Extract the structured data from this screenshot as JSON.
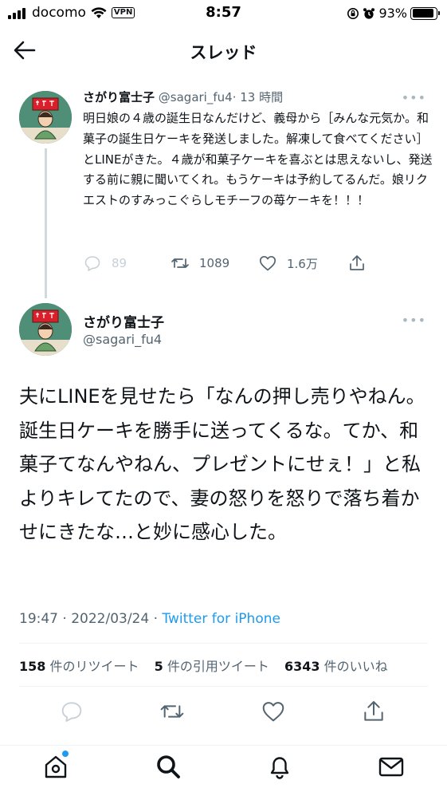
{
  "status_bar": {
    "carrier": "docomo",
    "vpn": "VPN",
    "time": "8:57",
    "battery": "93%",
    "battery_level": 0.93
  },
  "header": {
    "title": "スレッド",
    "back_icon": "arrow-left-icon"
  },
  "parent_tweet": {
    "name": "さがり富士子",
    "handle": "@sagari_fu4",
    "time": "· 13 時間",
    "text": "明日娘の４歳の誕生日なんだけど、義母から［みんな元気か。和菓子の誕生日ケーキを発送しました。解凍して食べてください］とLINEがきた。４歳が和菓子ケーキを喜ぶとは思えないし、発送する前に親に聞いてくれ。もうケーキは予約してるんだ。娘リクエストのすみっこぐらしモチーフの苺ケーキを！！！",
    "replies": "89",
    "retweets": "1089",
    "likes": "1.6万"
  },
  "main_tweet": {
    "name": "さがり富士子",
    "handle": "@sagari_fu4",
    "text": "夫にLINEを見せたら「なんの押し売りやねん。誕生日ケーキを勝手に送ってくるな。てか、和菓子てなんやねん、プレゼントにせぇ！」と私よりキレてたので、妻の怒りを怒りで落ち着かせにきたな…と妙に感心した。",
    "date": "19:47 · 2022/03/24 · ",
    "client": "Twitter for iPhone",
    "retweet_count": "158",
    "retweet_label": "件のリツイート",
    "quote_count": "5",
    "quote_label": "件の引用ツイート",
    "like_count": "6343",
    "like_label": "件のいいね"
  },
  "colors": {
    "text": "#0f1419",
    "secondary": "#536471",
    "accent": "#1d9bf0",
    "divider": "#eff3f4"
  },
  "icons": {
    "reply": "reply-icon",
    "retweet": "retweet-icon",
    "like": "heart-icon",
    "share": "share-icon",
    "home": "home-icon",
    "search": "search-icon",
    "notifications": "bell-icon",
    "messages": "mail-icon"
  }
}
